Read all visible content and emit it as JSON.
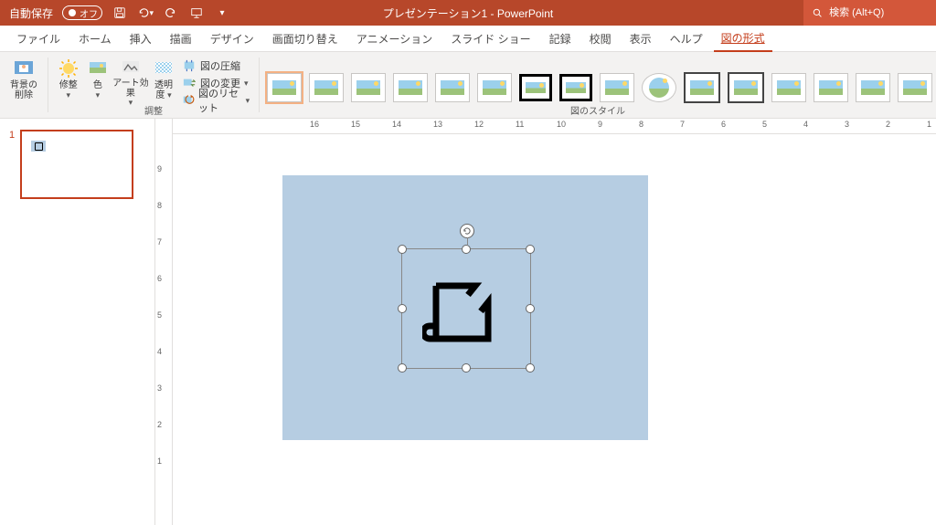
{
  "titlebar": {
    "autosave_label": "自動保存",
    "autosave_state": "オフ",
    "title": "プレゼンテーション1  -  PowerPoint",
    "search_placeholder": "検索 (Alt+Q)"
  },
  "tabs": {
    "file": "ファイル",
    "home": "ホーム",
    "insert": "挿入",
    "draw": "描画",
    "design": "デザイン",
    "transitions": "画面切り替え",
    "animations": "アニメーション",
    "slideshow": "スライド ショー",
    "record": "記録",
    "review": "校閲",
    "view": "表示",
    "help": "ヘルプ",
    "picture_format": "図の形式"
  },
  "ribbon": {
    "remove_bg": "背景の\n削除",
    "corrections": "修整",
    "color": "色",
    "artistic": "アート効果",
    "transparency": "透明\n度",
    "compress": "図の圧縮",
    "change": "図の変更",
    "reset": "図のリセット",
    "group_adjust": "調整",
    "group_styles": "図のスタイル"
  },
  "ruler": {
    "h": [
      "16",
      "15",
      "14",
      "13",
      "12",
      "11",
      "10",
      "9",
      "8",
      "7",
      "6",
      "5",
      "4",
      "3",
      "2",
      "1"
    ],
    "v": [
      "9",
      "8",
      "7",
      "6",
      "5",
      "4",
      "3",
      "2",
      "1"
    ]
  },
  "slide": {
    "number": "1"
  }
}
